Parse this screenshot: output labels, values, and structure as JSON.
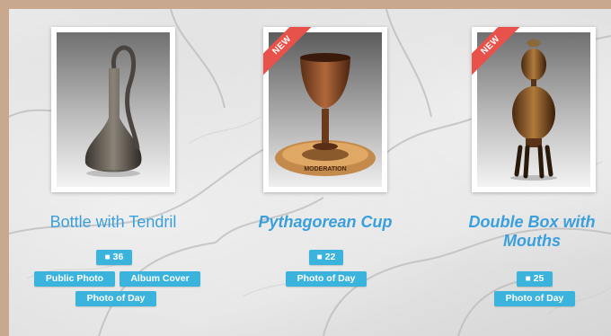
{
  "items": [
    {
      "title": "Bottle with Tendril",
      "comments": "36",
      "tags": [
        "Public Photo",
        "Album Cover",
        "Photo of Day"
      ],
      "is_new": false
    },
    {
      "title": "Pythagorean Cup",
      "comments": "22",
      "tags": [
        "Photo of Day"
      ],
      "is_new": true,
      "plate_text": "MODERATION"
    },
    {
      "title": "Double Box with Mouths",
      "comments": "25",
      "tags": [
        "Photo of Day"
      ],
      "is_new": true
    }
  ],
  "badge": {
    "new_label": "NEW"
  },
  "icons": {
    "comment": "comment-icon"
  },
  "colors": {
    "title": "#3aa0dd",
    "tag": "#3ab3dd",
    "ribbon": "#e8524a",
    "frame": "#c8a88f"
  }
}
